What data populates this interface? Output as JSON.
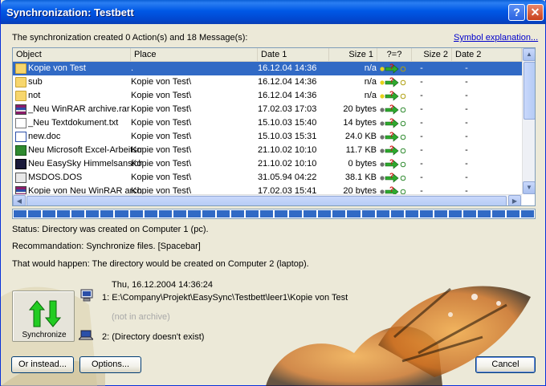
{
  "window": {
    "title": "Synchronization: Testbett",
    "help_button": "?",
    "close_button": "✕"
  },
  "summary": "The synchronization created 0 Action(s) and 18 Message(s):",
  "symbol_link": "Symbol explanation...",
  "columns": [
    "Object",
    "Place",
    "Date 1",
    "Size 1",
    "?=?",
    "Size 2",
    "Date 2"
  ],
  "rows": [
    {
      "icon": "folder-icon",
      "object": "Kopie von Test",
      "place": ".",
      "date1": "16.12.04 14:36",
      "size1": "n/a",
      "size2": "-",
      "date2": "-",
      "selected": true
    },
    {
      "icon": "folder-icon",
      "object": "sub",
      "place": "Kopie von Test\\",
      "date1": "16.12.04 14:36",
      "size1": "n/a",
      "size2": "-",
      "date2": "-"
    },
    {
      "icon": "folder-icon",
      "object": "not",
      "place": "Kopie von Test\\",
      "date1": "16.12.04 14:36",
      "size1": "n/a",
      "size2": "-",
      "date2": "-"
    },
    {
      "icon": "rar-icon",
      "object": "_Neu WinRAR archive.rar",
      "place": "Kopie von Test\\",
      "date1": "17.02.03 17:03",
      "size1": "20 bytes",
      "size2": "-",
      "date2": "-"
    },
    {
      "icon": "text-file-icon",
      "object": "_Neu Textdokument.txt",
      "place": "Kopie von Test\\",
      "date1": "15.10.03 15:40",
      "size1": "14 bytes",
      "size2": "-",
      "date2": "-"
    },
    {
      "icon": "word-doc-icon",
      "object": "new.doc",
      "place": "Kopie von Test\\",
      "date1": "15.10.03 15:31",
      "size1": "24.0 KB",
      "size2": "-",
      "date2": "-"
    },
    {
      "icon": "excel-icon",
      "object": "Neu Microsoft Excel-Arbeitsmappe.xls",
      "place": "Kopie von Test\\",
      "date1": "21.10.02 10:10",
      "size1": "11.7 KB",
      "size2": "-",
      "date2": "-"
    },
    {
      "icon": "screensaver-icon",
      "object": "Neu EasySky Himmelsansicht",
      "place": "Kopie von Test\\",
      "date1": "21.10.02 10:10",
      "size1": "0 bytes",
      "size2": "-",
      "date2": "-"
    },
    {
      "icon": "dos-file-icon",
      "object": "MSDOS.DOS",
      "place": "Kopie von Test\\",
      "date1": "31.05.94 04:22",
      "size1": "38.1 KB",
      "size2": "-",
      "date2": "-"
    },
    {
      "icon": "rar-icon",
      "object": "Kopie von Neu WinRAR archive.rar",
      "place": "Kopie von Test\\",
      "date1": "17.02.03 15:41",
      "size1": "20 bytes",
      "size2": "-",
      "date2": "-"
    }
  ],
  "status": "Status: Directory was created on Computer 1 (pc).",
  "recommendation": "Recommandation: Synchronize files. [Spacebar]",
  "would_happen": "That would happen: The directory would be created on Computer 2 (laptop).",
  "detail": {
    "timestamp": "Thu, 16.12.2004 14:36:24",
    "path1": "1: E:\\Company\\Projekt\\EasySync\\Testbett\\leer1\\Kopie von Test",
    "archive_note": "(not in archive)",
    "path2": "2: (Directory doesn't exist)"
  },
  "buttons": {
    "synchronize": "Synchronize",
    "or_instead": "Or instead...",
    "options": "Options...",
    "cancel": "Cancel"
  },
  "progress_blocks": 36,
  "colors": {
    "selection": "#316ac5",
    "title_bar": "#0058e6",
    "link": "#0000cc",
    "sync_arrows": "#22cc22"
  }
}
